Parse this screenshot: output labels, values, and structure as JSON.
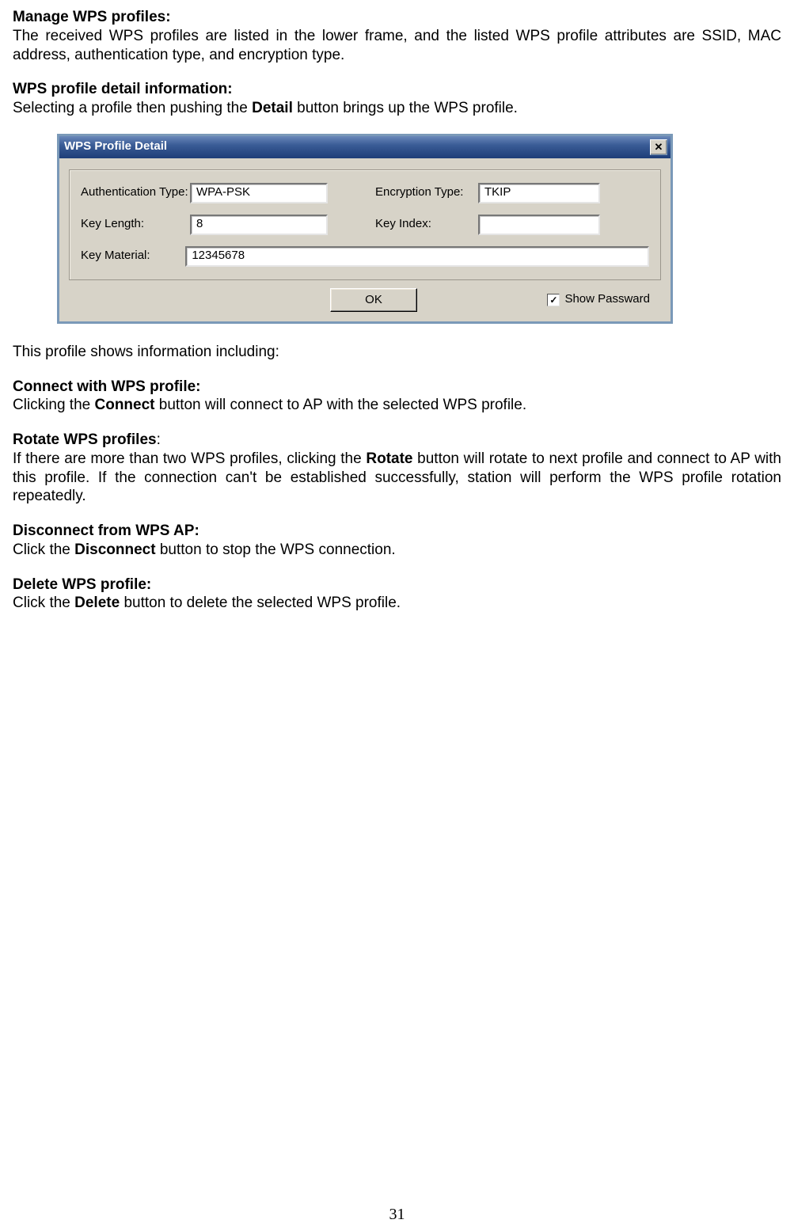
{
  "page_number": "31",
  "sections": {
    "manage": {
      "heading": "Manage WPS profiles:",
      "body": "The received WPS profiles are listed in the lower frame, and the listed WPS profile attributes are SSID, MAC address, authentication type, and encryption type."
    },
    "detail": {
      "heading": "WPS profile detail information:",
      "body_pre": "Selecting a profile then pushing the ",
      "body_bold": "Detail",
      "body_post": " button brings up the WPS profile."
    },
    "after_dialog": "This profile shows information including:",
    "connect": {
      "heading": "Connect with WPS profile:",
      "body_pre": "Clicking the ",
      "body_bold": "Connect",
      "body_post": " button will connect to AP with the selected WPS profile."
    },
    "rotate": {
      "heading": "Rotate WPS profiles",
      "colon": ":",
      "body_pre": "If there are more than two WPS profiles, clicking the ",
      "body_bold": "Rotate",
      "body_post": " button will rotate to next profile and connect to AP with this profile. If the connection can't be established successfully, station will perform the WPS profile rotation repeatedly."
    },
    "disconnect": {
      "heading": "Disconnect from WPS AP:",
      "body_pre": "Click the ",
      "body_bold": "Disconnect",
      "body_post": " button to stop the WPS connection."
    },
    "delete": {
      "heading": "Delete WPS profile:",
      "body_pre": "Click the ",
      "body_bold": "Delete",
      "body_post": " button to delete the selected WPS profile."
    }
  },
  "dialog": {
    "title": "WPS Profile Detail",
    "close_glyph": "✕",
    "labels": {
      "auth_type": "Authentication Type:",
      "encryption_type": "Encryption Type:",
      "key_length": "Key Length:",
      "key_index": "Key Index:",
      "key_material": "Key Material:"
    },
    "values": {
      "auth_type": "WPA-PSK",
      "encryption_type": "TKIP",
      "key_length": "8",
      "key_index": "",
      "key_material": "12345678"
    },
    "ok_label": "OK",
    "show_password_label": "Show Passward",
    "show_password_checked": "✓"
  }
}
